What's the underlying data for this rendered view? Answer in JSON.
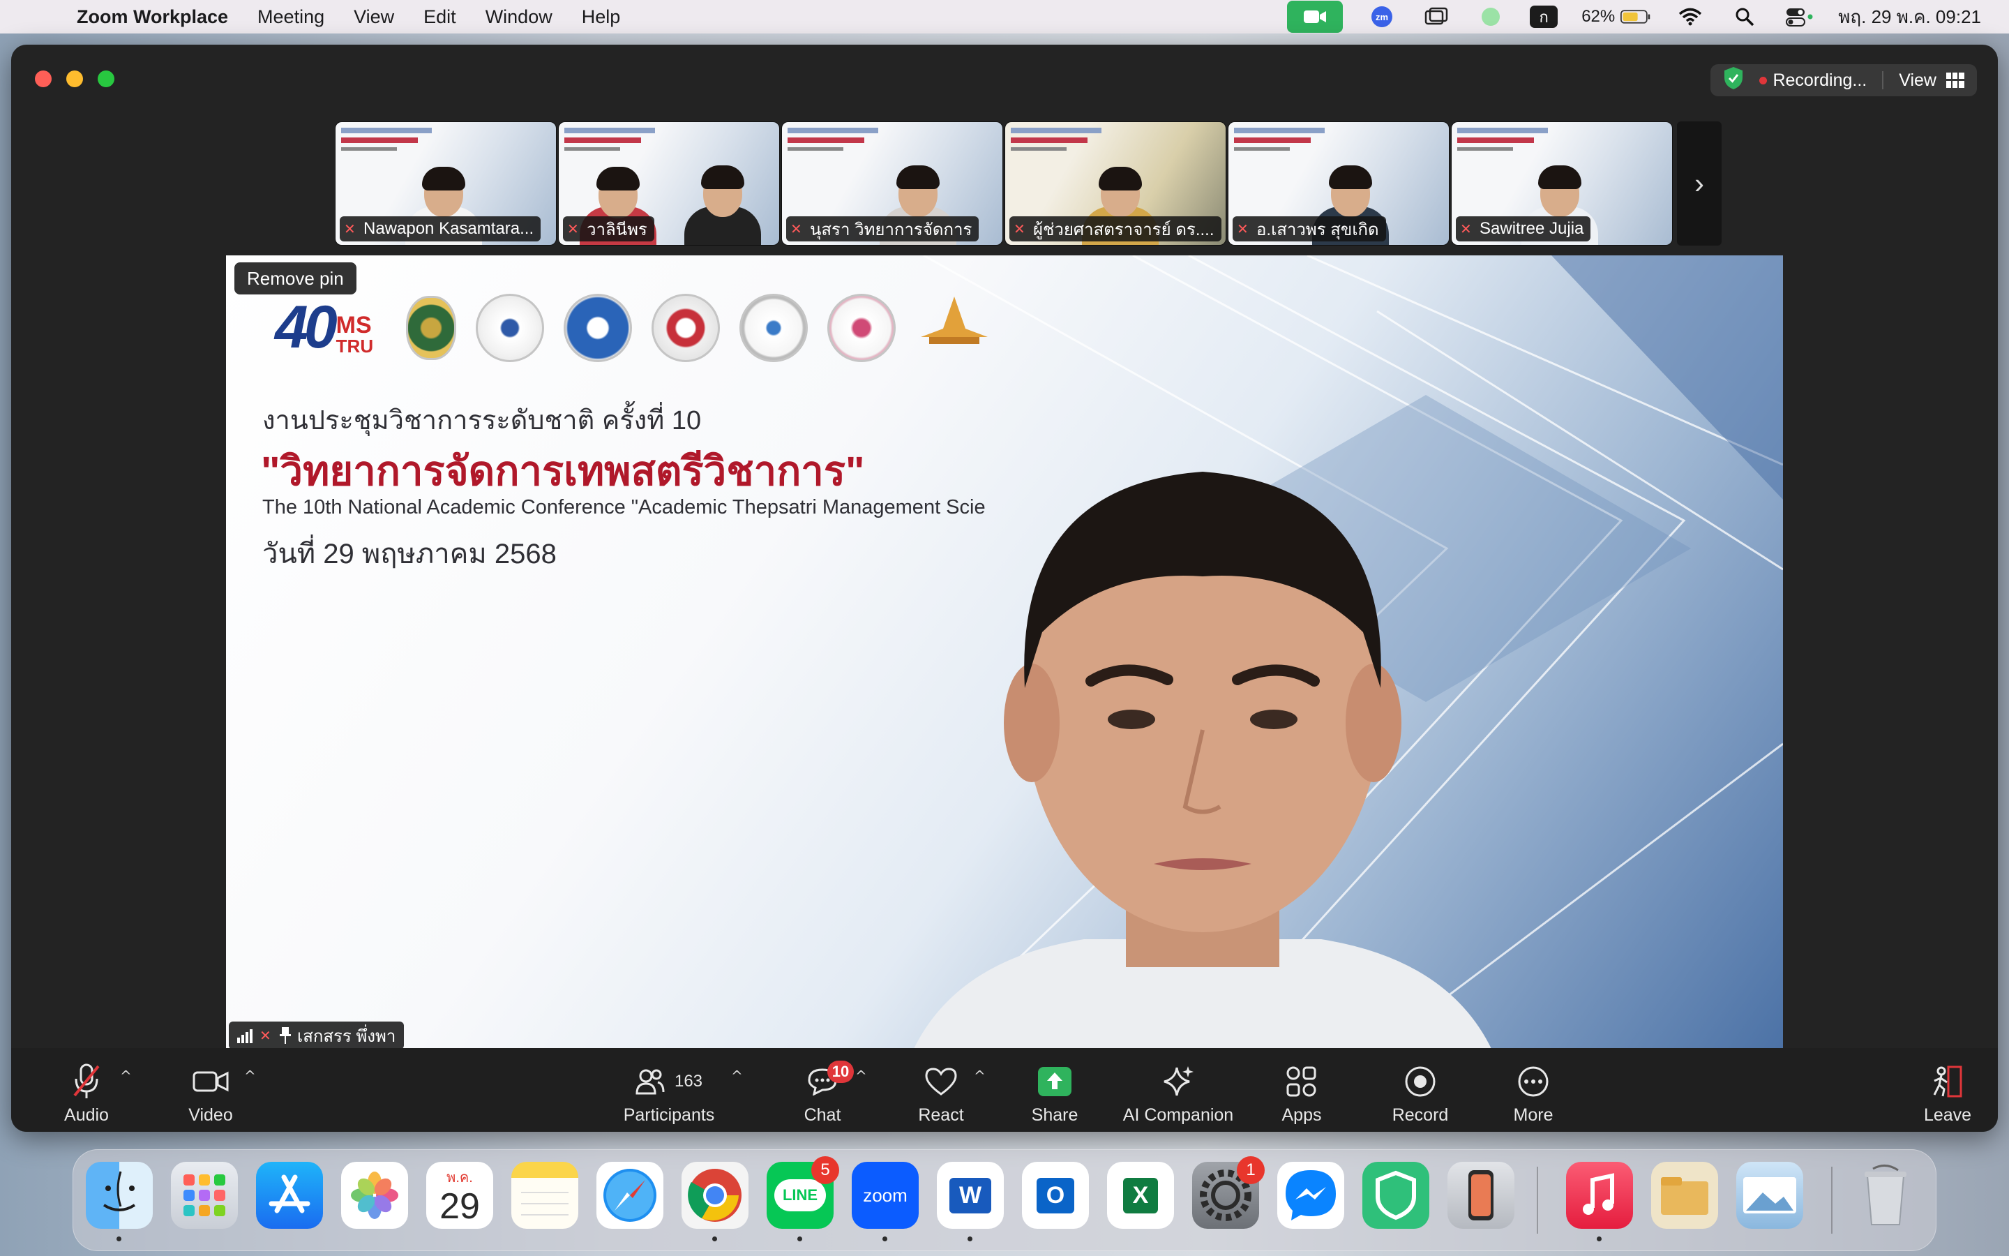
{
  "menubar": {
    "app_name": "Zoom Workplace",
    "items": [
      "Meeting",
      "View",
      "Edit",
      "Window",
      "Help"
    ],
    "battery": "62%",
    "input_source": "ก",
    "datetime": "พฤ. 29 พ.ค.  09:21"
  },
  "titlebar": {
    "recording_label": "Recording...",
    "view_label": "View"
  },
  "filmstrip": {
    "participants": [
      {
        "name": "Nawapon Kasamtara..."
      },
      {
        "name": "วาลินีพร"
      },
      {
        "name": "นุสรา วิทยาการจัดการ"
      },
      {
        "name": "ผู้ช่วยศาสตราจารย์ ดร...."
      },
      {
        "name": "อ.เสาวพร สุขเกิด"
      },
      {
        "name": "Sawitree Jujia"
      }
    ]
  },
  "main_video": {
    "remove_pin_label": "Remove pin",
    "speaker_name": "เสกสรร พึ่งพา",
    "slide": {
      "logo_text_40": "40",
      "logo_text_ms": "MS",
      "logo_text_tru": "TRU",
      "line1": "งานประชุมวิชาการระดับชาติ ครั้งที่ 10",
      "line2": "\"วิทยาการจัดการเทพสตรีวิชาการ\"",
      "line3": "The 10th National Academic Conference \"Academic Thepsatri Management Scie",
      "line4": "วันที่ 29 พฤษภาคม 2568"
    }
  },
  "toolbar": {
    "audio": "Audio",
    "video": "Video",
    "participants": "Participants",
    "participants_count": "163",
    "chat": "Chat",
    "chat_badge": "10",
    "react": "React",
    "share": "Share",
    "ai_companion": "AI Companion",
    "apps": "Apps",
    "record": "Record",
    "more": "More",
    "leave": "Leave"
  },
  "dock": {
    "calendar_month": "พ.ค.",
    "calendar_day": "29",
    "line_badge": "5",
    "settings_badge": "1",
    "line_label": "LINE",
    "zoom_label": "zoom",
    "word_label": "W",
    "outlook_label": "O",
    "excel_label": "X"
  },
  "colors": {
    "accent_green": "#2fb35d",
    "record_red": "#e0363a",
    "slide_title_red": "#b0182a"
  }
}
